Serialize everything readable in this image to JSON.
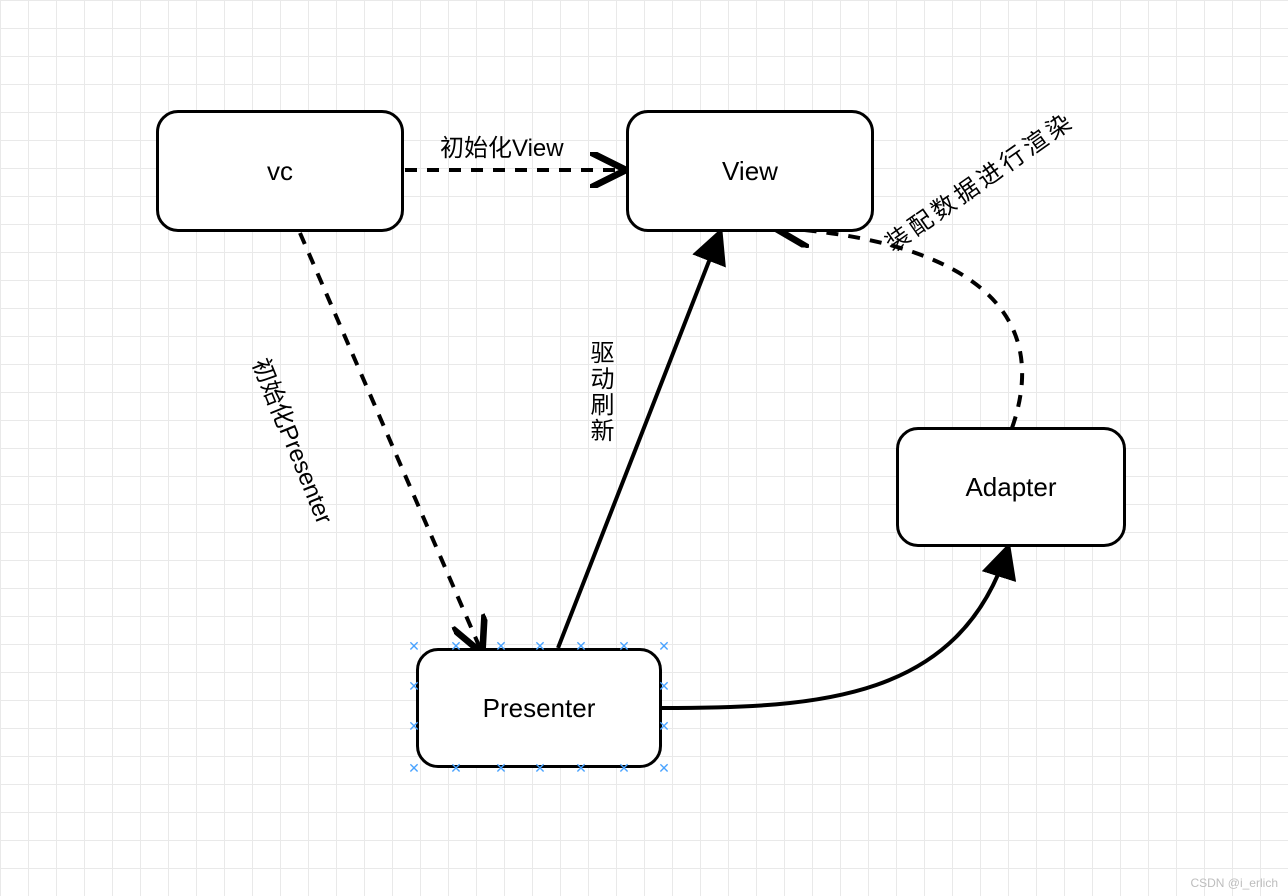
{
  "nodes": {
    "vc": {
      "label": "vc"
    },
    "view": {
      "label": "View"
    },
    "presenter": {
      "label": "Presenter"
    },
    "adapter": {
      "label": "Adapter"
    }
  },
  "edges": {
    "vc_to_view": {
      "label": "初始化View"
    },
    "vc_to_presenter": {
      "label": "初始化Presenter"
    },
    "presenter_to_view": {
      "label": "驱动刷新"
    },
    "presenter_to_adapter": {
      "label": ""
    },
    "adapter_to_view": {
      "label": "装配数据进行渲染"
    }
  },
  "watermark": "CSDN @i_erlich"
}
